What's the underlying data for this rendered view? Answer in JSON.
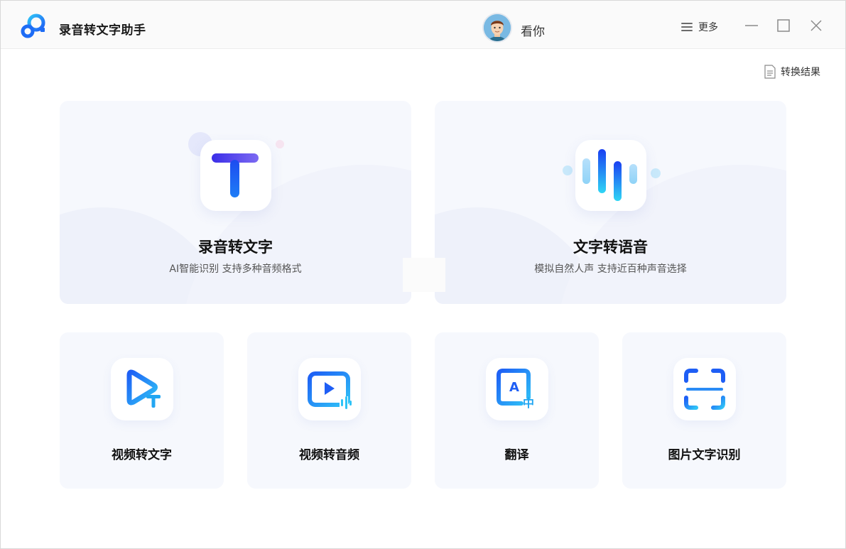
{
  "header": {
    "app_title": "录音转文字助手",
    "username": "看你",
    "more_label": "更多"
  },
  "toolbar": {
    "result_label": "转换结果"
  },
  "main_features": [
    {
      "title": "录音转文字",
      "subtitle": "AI智能识别 支持多种音频格式",
      "icon": "text-t-icon"
    },
    {
      "title": "文字转语音",
      "subtitle": "模拟自然人声 支持近百种声音选择",
      "icon": "sound-wave-icon"
    }
  ],
  "tools": [
    {
      "title": "视频转文字",
      "icon": "video-to-text-icon"
    },
    {
      "title": "视频转音频",
      "icon": "video-to-audio-icon"
    },
    {
      "title": "翻译",
      "icon": "translate-icon"
    },
    {
      "title": "图片文字识别",
      "icon": "scan-icon"
    }
  ],
  "colors": {
    "accent": "#1e6cf5",
    "accent_light": "#2fc3f7",
    "card_bg": "#f6f8fd"
  }
}
